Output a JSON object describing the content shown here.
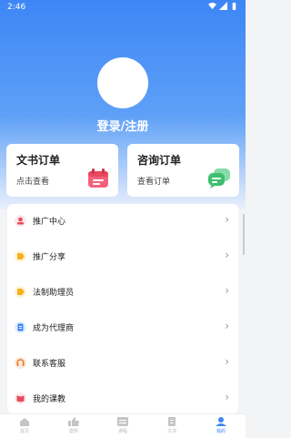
{
  "status_bar": {
    "time": "2:46"
  },
  "profile": {
    "login_label": "登录/注册"
  },
  "cards": [
    {
      "title": "文书订单",
      "subtitle": "点击查看",
      "icon": "calendar-icon"
    },
    {
      "title": "咨询订单",
      "subtitle": "查看订单",
      "icon": "chat-bubbles-icon"
    }
  ],
  "menu": [
    {
      "label": "推广中心",
      "icon": "user-pin-icon",
      "color": "#e84b5a"
    },
    {
      "label": "推广分享",
      "icon": "tag-icon",
      "color": "#f6b21c"
    },
    {
      "label": "法制助理员",
      "icon": "tag-icon",
      "color": "#f6b21c"
    },
    {
      "label": "成为代理商",
      "icon": "document-icon",
      "color": "#3d86f6"
    },
    {
      "label": "联系客服",
      "icon": "headset-icon",
      "color": "#f07a2d"
    },
    {
      "label": "我的课教",
      "icon": "book-icon",
      "color": "#e84b5a"
    }
  ],
  "tabbar": [
    {
      "label": "首页",
      "icon": "home-icon",
      "active": false
    },
    {
      "label": "案例",
      "icon": "thumbs-up-icon",
      "active": false
    },
    {
      "label": "课程",
      "icon": "course-icon",
      "active": false
    },
    {
      "label": "文书",
      "icon": "file-icon",
      "active": false
    },
    {
      "label": "我的",
      "icon": "profile-icon",
      "active": true
    }
  ],
  "colors": {
    "accent": "#3d86f6",
    "chevron": "#999999"
  }
}
